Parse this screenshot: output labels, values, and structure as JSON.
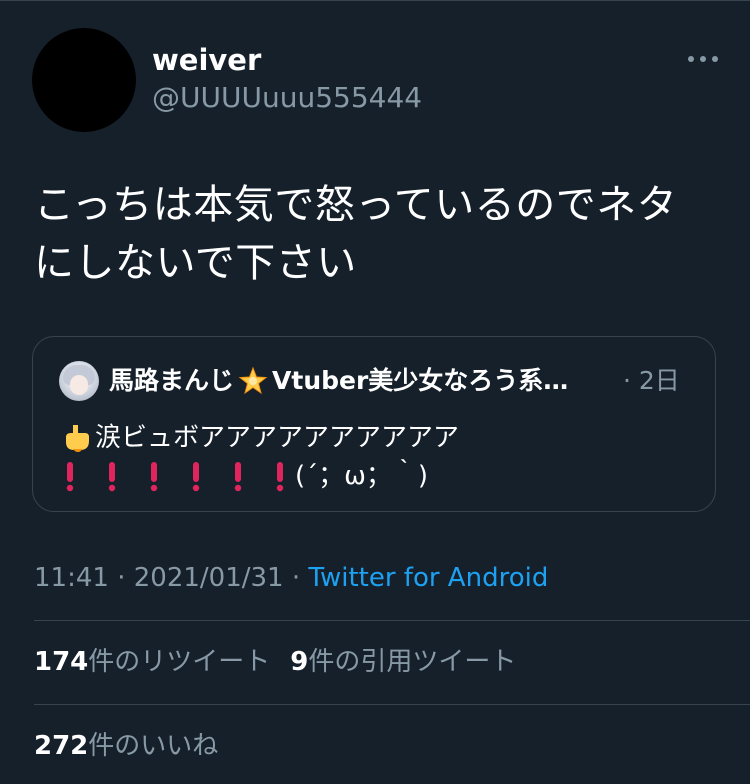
{
  "author": {
    "name": "weiver",
    "handle": "@UUUUuuu555444"
  },
  "tweet": {
    "text_lines": [
      "こっちは本気で怒っているのでネタ",
      "にしないで下さい"
    ]
  },
  "quote": {
    "name_part1": "馬路まんじ",
    "name_part2": "Vtuber美少女なろう系…",
    "time": "· 2日",
    "line1": "涙ビュボアアアアアアアアアア",
    "line2_suffix": "(´；ω；｀)",
    "icons": {
      "star": "glowing-star-emoji",
      "hand": "backhand-index-pointing-down-emoji",
      "exclamation": "red-exclamation-mark-emoji"
    }
  },
  "meta": {
    "time": "11:41",
    "sep1": " · ",
    "date": "2021/01/31",
    "sep2": " · ",
    "source": "Twitter for Android"
  },
  "stats": {
    "retweets_count": "174",
    "retweets_label": "件のリツイート",
    "quotes_count": "9",
    "quotes_label": "件の引用ツイート",
    "likes_count": "272",
    "likes_label": "件のいいね"
  },
  "colors": {
    "background": "#15202b",
    "border": "#38444d",
    "secondary_text": "#8899a6",
    "link": "#1da1f2",
    "exclamation": "#e0245e"
  }
}
